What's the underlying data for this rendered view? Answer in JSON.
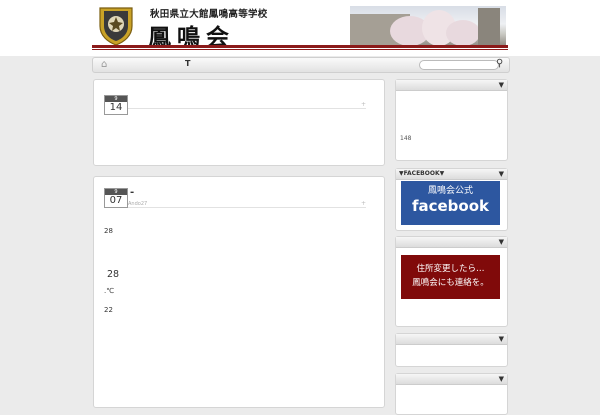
{
  "header": {
    "school_name": "秋田県立大館鳳鳴高等学校",
    "org_name": "鳳鳴会"
  },
  "nav": {
    "item_t": "T",
    "search_placeholder": ""
  },
  "posts": [
    {
      "month": "9",
      "day": "14",
      "meta": "",
      "title": "",
      "body": []
    },
    {
      "month": "9",
      "day": "07",
      "title": "-",
      "meta": "Ando27",
      "body": [
        "28",
        "28",
        ".℃",
        "22"
      ]
    }
  ],
  "sidebar": {
    "widget1": {
      "title": "",
      "count": "148"
    },
    "facebook": {
      "title": "▼FACEBOOK▼",
      "banner_jp": "鳳鳴会公式",
      "banner_word": "facebook"
    },
    "address": {
      "title": "",
      "line1": "住所変更したら…",
      "line2": "鳳鳴会にも連絡を。"
    },
    "widget4": {
      "title": ""
    },
    "widget5": {
      "title": ""
    }
  },
  "colors": {
    "rule": "#8b1a1a",
    "facebook_blue": "#2d57a0",
    "address_red": "#800a0a"
  }
}
